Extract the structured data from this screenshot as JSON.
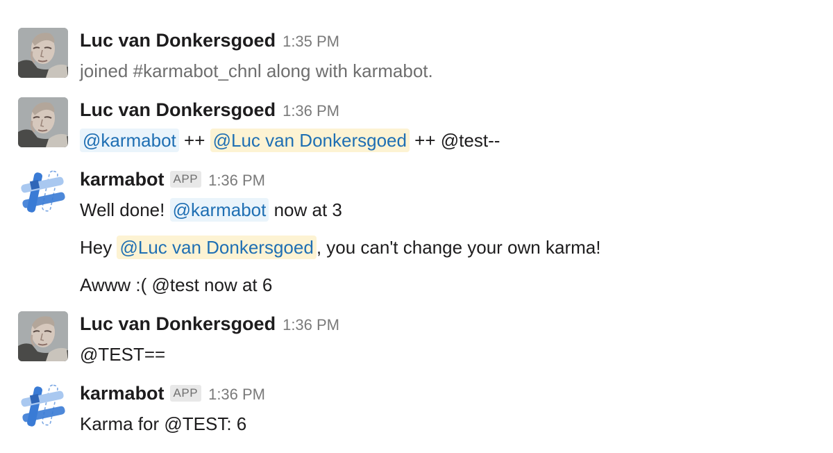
{
  "messages": [
    {
      "author": "Luc van Donkersgoed",
      "time": "1:35 PM",
      "system_text": "joined #karmabot_chnl along with karmabot."
    },
    {
      "author": "Luc van Donkersgoed",
      "time": "1:36 PM",
      "parts": {
        "mention1": "@karmabot",
        "text1": " ++ ",
        "mention2": "@Luc van Donkersgoed",
        "text2": " ++ @test--"
      }
    },
    {
      "author": "karmabot",
      "badge": "APP",
      "time": "1:36 PM",
      "line1": {
        "text1": "Well done! ",
        "mention": "@karmabot",
        "text2": " now at 3"
      },
      "line2": {
        "text1": "Hey ",
        "mention": "@Luc van Donkersgoed",
        "text2": ", you can't change your own karma!"
      },
      "line3": "Awww :( @test now at 6"
    },
    {
      "author": "Luc van Donkersgoed",
      "time": "1:36 PM",
      "text": "@TEST=="
    },
    {
      "author": "karmabot",
      "badge": "APP",
      "time": "1:36 PM",
      "text": "Karma for @TEST: 6"
    }
  ],
  "icons": {
    "user_avatar": "user-photo-avatar",
    "bot_avatar": "karmabot-hash-avatar"
  },
  "colors": {
    "mention_text": "#1f6fb3",
    "mention_bg": "#eaf4fb",
    "self_mention_bg": "#fdf3d3",
    "bot_blue": "#3a7bd5",
    "bot_light_blue": "#a9c8f0"
  }
}
